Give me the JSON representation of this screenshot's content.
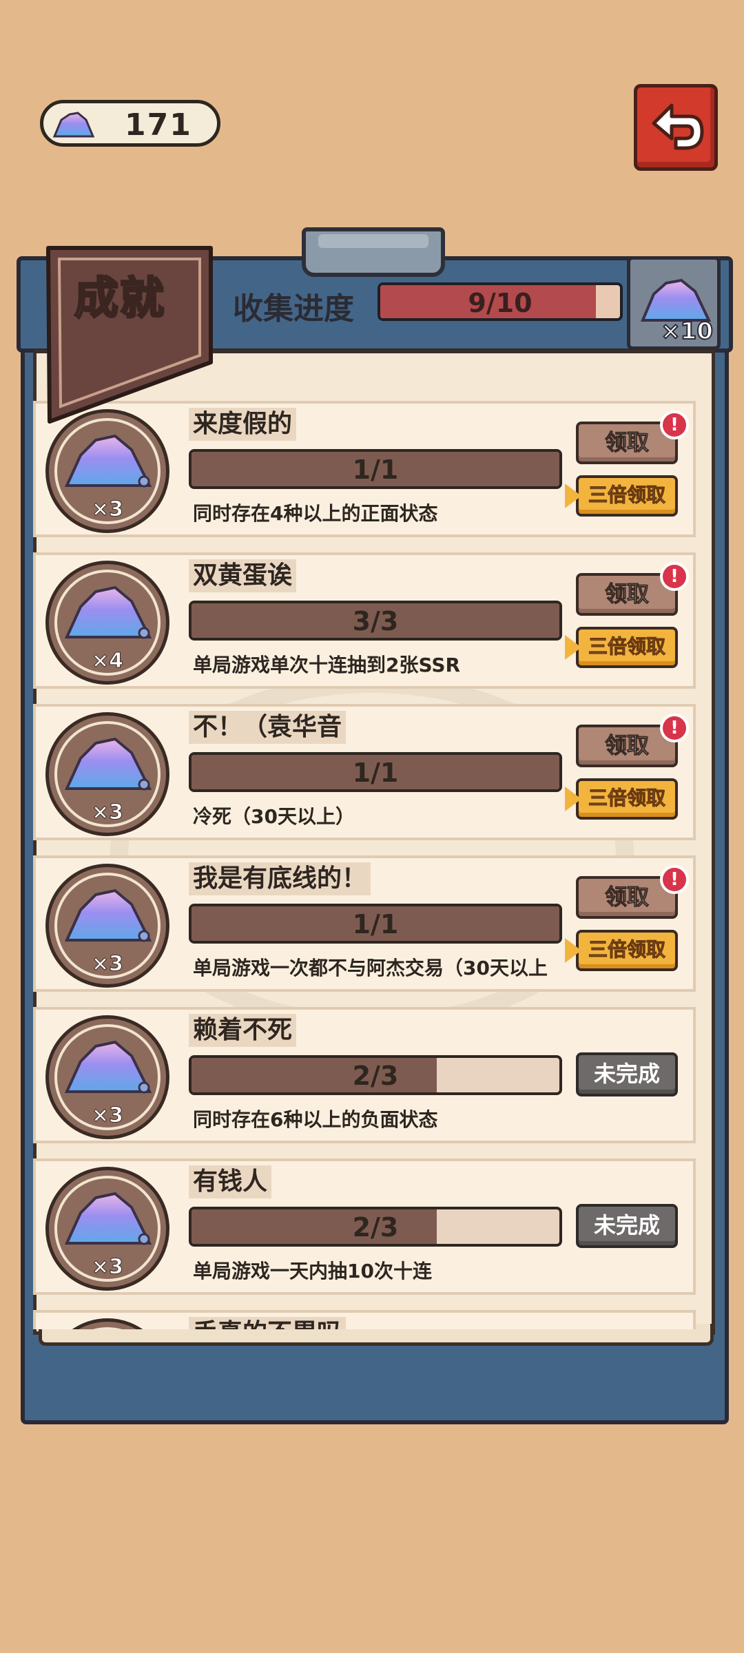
{
  "currency": {
    "value": "171",
    "icon": "crystal-icon"
  },
  "header": {
    "title": "成就",
    "progress_label": "收集进度",
    "progress_text": "9/10",
    "progress_fraction": 0.9,
    "reward_count": "×10"
  },
  "achievements": [
    {
      "name": "来度假的",
      "progress": "1/1",
      "fraction": 1.0,
      "desc": "同时存在4种以上的正面状态",
      "reward": "×3",
      "state": "claimable",
      "claim_label": "领取",
      "triple_label": "三倍领取",
      "badge": "!"
    },
    {
      "name": "双黄蛋诶",
      "progress": "3/3",
      "fraction": 1.0,
      "desc": "单局游戏单次十连抽到2张SSR",
      "reward": "×4",
      "state": "claimable",
      "claim_label": "领取",
      "triple_label": "三倍领取",
      "badge": "!"
    },
    {
      "name": "不！（袁华音",
      "progress": "1/1",
      "fraction": 1.0,
      "desc": "冷死（30天以上）",
      "reward": "×3",
      "state": "claimable",
      "claim_label": "领取",
      "triple_label": "三倍领取",
      "badge": "!"
    },
    {
      "name": "我是有底线的！",
      "progress": "1/1",
      "fraction": 1.0,
      "desc": "单局游戏一次都不与阿杰交易（30天以上",
      "reward": "×3",
      "state": "claimable",
      "claim_label": "领取",
      "triple_label": "三倍领取",
      "badge": "!"
    },
    {
      "name": "赖着不死",
      "progress": "2/3",
      "fraction": 0.6667,
      "desc": "同时存在6种以上的负面状态",
      "reward": "×3",
      "state": "incomplete",
      "incomplete_label": "未完成"
    },
    {
      "name": "有钱人",
      "progress": "2/3",
      "fraction": 0.6667,
      "desc": "单局游戏一天内抽10次十连",
      "reward": "×3",
      "state": "incomplete",
      "incomplete_label": "未完成"
    },
    {
      "name": "手真的不累吗",
      "progress": "",
      "fraction": 0,
      "desc": "",
      "reward": "",
      "state": "partial"
    }
  ],
  "colors": {
    "background": "#e3b98c",
    "board": "#436688",
    "paper": "#f5e9d6",
    "progress_fill": "#b34a4d",
    "item_fill": "#7e5b50",
    "claim_button": "#b08675",
    "triple_button": "#f3b43e",
    "incomplete_button": "#6f6a6a",
    "back_button": "#d23a2b"
  }
}
